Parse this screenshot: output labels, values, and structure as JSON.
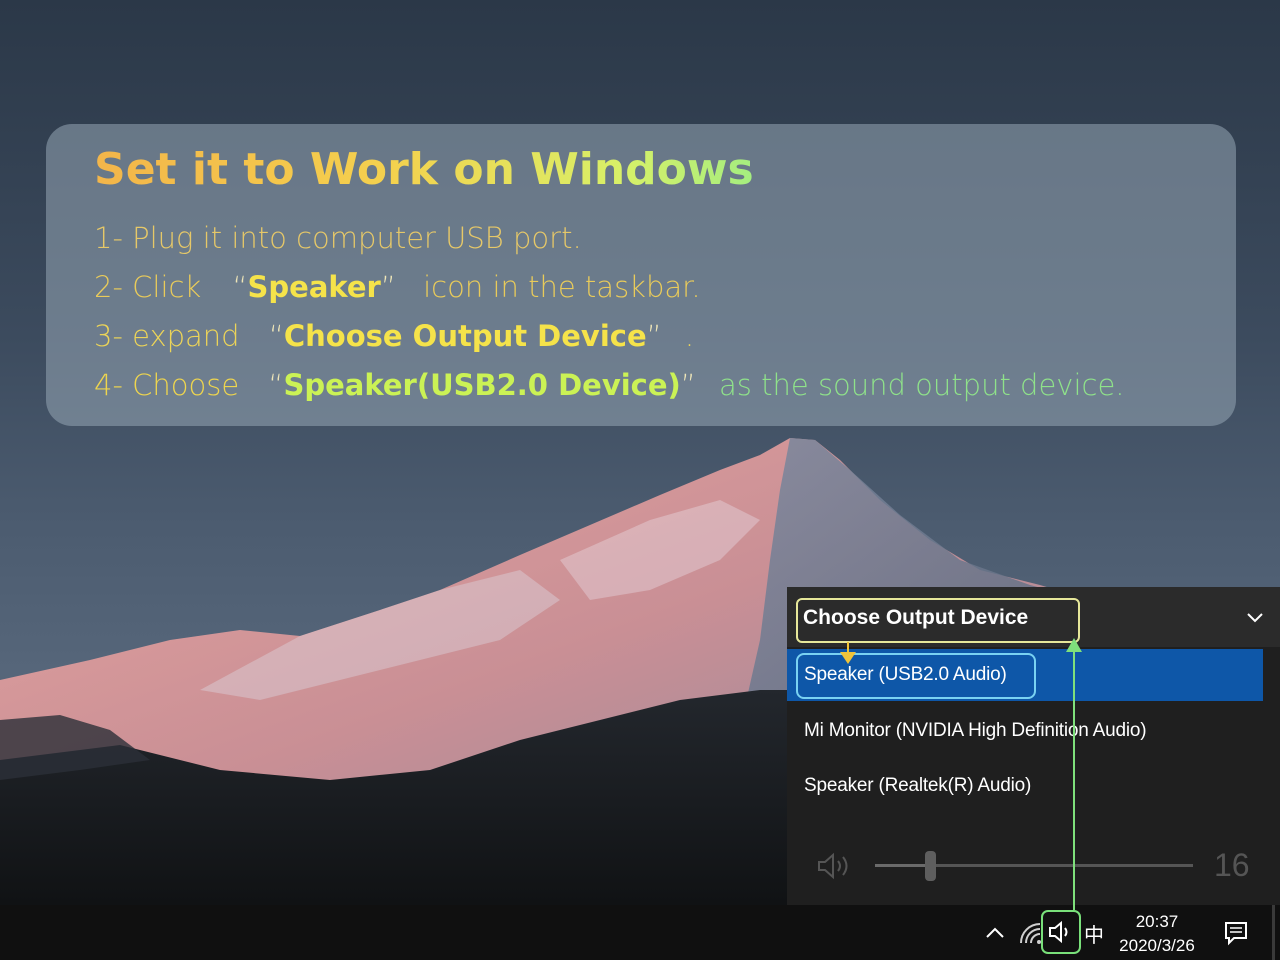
{
  "instructions": {
    "title": "Set it to Work on Windows",
    "steps": [
      {
        "prefix": "1- Plug it into computer USB port."
      },
      {
        "prefix": "2- Click",
        "open_q": "“",
        "highlight": "Speaker",
        "close_q": "”",
        "suffix": "icon in the taskbar."
      },
      {
        "prefix": "3- expand",
        "open_q": "“",
        "highlight": "Choose Output Device",
        "close_q": "”",
        "suffix": "."
      },
      {
        "prefix": "4- Choose",
        "open_q": "“",
        "highlight": "Speaker(USB2.0 Device)",
        "close_q": "”",
        "suffix": "as the sound output device."
      }
    ]
  },
  "flyout": {
    "header": "Choose Output Device",
    "devices": [
      {
        "label": "Speaker (USB2.0 Audio)",
        "selected": true
      },
      {
        "label": "Mi Monitor (NVIDIA High Definition Audio)",
        "selected": false
      },
      {
        "label": "Speaker (Realtek(R) Audio)",
        "selected": false
      }
    ],
    "volume": {
      "value": "16",
      "level": 0.16
    }
  },
  "taskbar": {
    "ime": "中",
    "time": "20:37",
    "date": "2020/3/26",
    "icons": [
      "chevron-up-icon",
      "network-icon",
      "speaker-icon",
      "notification-icon"
    ]
  },
  "colors": {
    "accent_selected": "#0e57a8",
    "highlight_box": "#e6e79a",
    "selection_box": "#79d2f2",
    "arrow_green": "#7fe07c"
  }
}
